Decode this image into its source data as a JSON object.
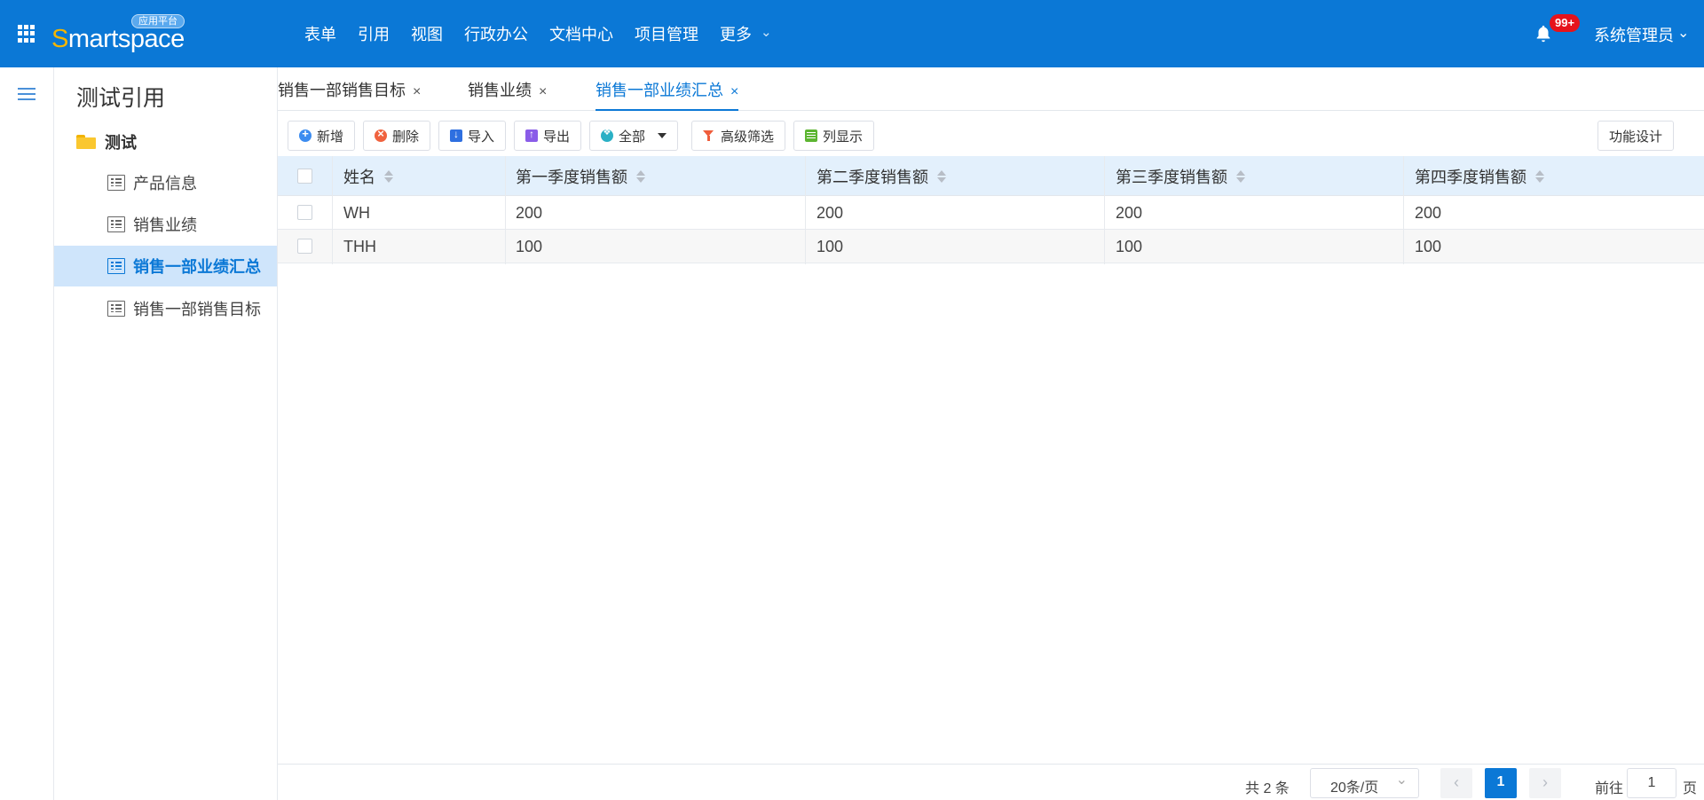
{
  "header": {
    "logo_text_first": "S",
    "logo_text_rest": "martspace",
    "logo_badge": "应用平台",
    "nav": [
      "表单",
      "引用",
      "视图",
      "行政办公",
      "文档中心",
      "项目管理",
      "更多"
    ],
    "notification_count": "99+",
    "user": "系统管理员"
  },
  "sidebar": {
    "title": "测试引用",
    "folder": "测试",
    "items": [
      {
        "label": "产品信息",
        "active": false
      },
      {
        "label": "销售业绩",
        "active": false
      },
      {
        "label": "销售一部业绩汇总",
        "active": true
      },
      {
        "label": "销售一部销售目标",
        "active": false
      }
    ]
  },
  "tabs": [
    {
      "label": "销售一部销售目标",
      "close": "×",
      "active": false
    },
    {
      "label": "销售业绩",
      "close": "×",
      "active": false
    },
    {
      "label": "销售一部业绩汇总",
      "close": "×",
      "active": true
    }
  ],
  "toolbar": {
    "add": "新增",
    "delete": "删除",
    "import": "导入",
    "export": "导出",
    "scope": "全部",
    "advanced_filter": "高级筛选",
    "columns": "列显示",
    "design": "功能设计"
  },
  "table": {
    "columns": [
      "姓名",
      "第一季度销售额",
      "第二季度销售额",
      "第三季度销售额",
      "第四季度销售额"
    ],
    "rows": [
      [
        "WH",
        "200",
        "200",
        "200",
        "200"
      ],
      [
        "THH",
        "100",
        "100",
        "100",
        "100"
      ]
    ]
  },
  "pagination": {
    "total": "共 2 条",
    "page_size": "20条/页",
    "prev": "‹",
    "current": "1",
    "next": "›",
    "goto_label": "前往",
    "goto_value": "1",
    "goto_unit": "页"
  },
  "colors": {
    "primary": "#0b78d6",
    "header_bg": "#0b78d6",
    "active_row": "#cfe5fb",
    "table_head": "#e3f0fc"
  }
}
